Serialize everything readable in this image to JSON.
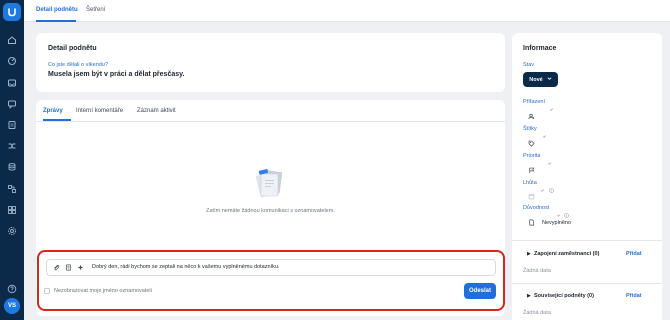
{
  "rail": {
    "avatar_initials": "VS",
    "icons": [
      "home-icon",
      "dashboard-icon",
      "inbox-icon",
      "chat-icon",
      "documents-icon",
      "folder-icon",
      "shuffle-icon",
      "database-icon",
      "workflow-icon",
      "apps-icon",
      "settings-icon",
      "help-icon"
    ]
  },
  "top_tabs": [
    {
      "label": "Detail podnětu",
      "active": true
    },
    {
      "label": "Šetření",
      "active": false
    }
  ],
  "detail": {
    "title": "Detail podnětu",
    "question_label": "Co jste dělali o víkendu?",
    "question_answer": "Musela jsem být v práci a dělat přesčasy."
  },
  "messages": {
    "tabs": [
      {
        "label": "Zprávy",
        "active": true
      },
      {
        "label": "Interní komentáře",
        "active": false
      },
      {
        "label": "Záznam aktivit",
        "active": false
      }
    ],
    "empty_text": "Zatím nemáte žádnou komunikaci s oznamovatelem.",
    "composer": {
      "value": "Dobrý den, rádi bychom se zeptali na něco k vašemu vyplněnému dotazníku.",
      "anonymous_label": "Nezobrazovat moje jméno oznamovateli",
      "send_label": "Odeslat"
    }
  },
  "info": {
    "title": "Informace",
    "status_label": "Stav",
    "status_value": "Nové",
    "assigned_label": "Přiřazení",
    "tags_label": "Štítky",
    "priority_label": "Priorita",
    "deadline_label": "Lhůta",
    "confidentiality_label": "Důvodnost",
    "confidentiality_value": "Nevyplněno",
    "sections": [
      {
        "title": "Zapojení zaměstnanci (0)",
        "add_label": "Přidat",
        "empty": "Žádná data"
      },
      {
        "title": "Související podněty (0)",
        "add_label": "Přidat",
        "empty": "Žádná data"
      }
    ]
  },
  "colors": {
    "accent": "#1f6fdc",
    "rail": "#0b2a4a",
    "highlight": "#d9261c"
  }
}
